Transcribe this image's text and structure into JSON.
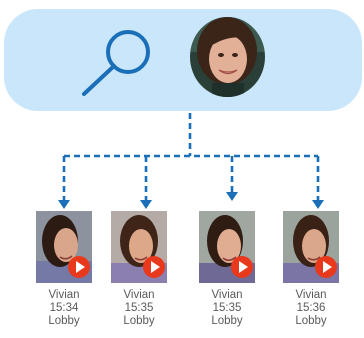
{
  "colors": {
    "panel_bg": "#c9e6fa",
    "accent_blue": "#1a6fb8",
    "play_red": "#e8391d",
    "caption_text": "#5a5a5a"
  },
  "icons": {
    "search": "search-icon",
    "play": "play-icon"
  },
  "results": [
    {
      "name": "Vivian",
      "time": "15:34",
      "location": "Lobby"
    },
    {
      "name": "Vivian",
      "time": "15:35",
      "location": "Lobby"
    },
    {
      "name": "Vivian",
      "time": "15:35",
      "location": "Lobby"
    },
    {
      "name": "Vivian",
      "time": "15:36",
      "location": "Lobby"
    }
  ]
}
